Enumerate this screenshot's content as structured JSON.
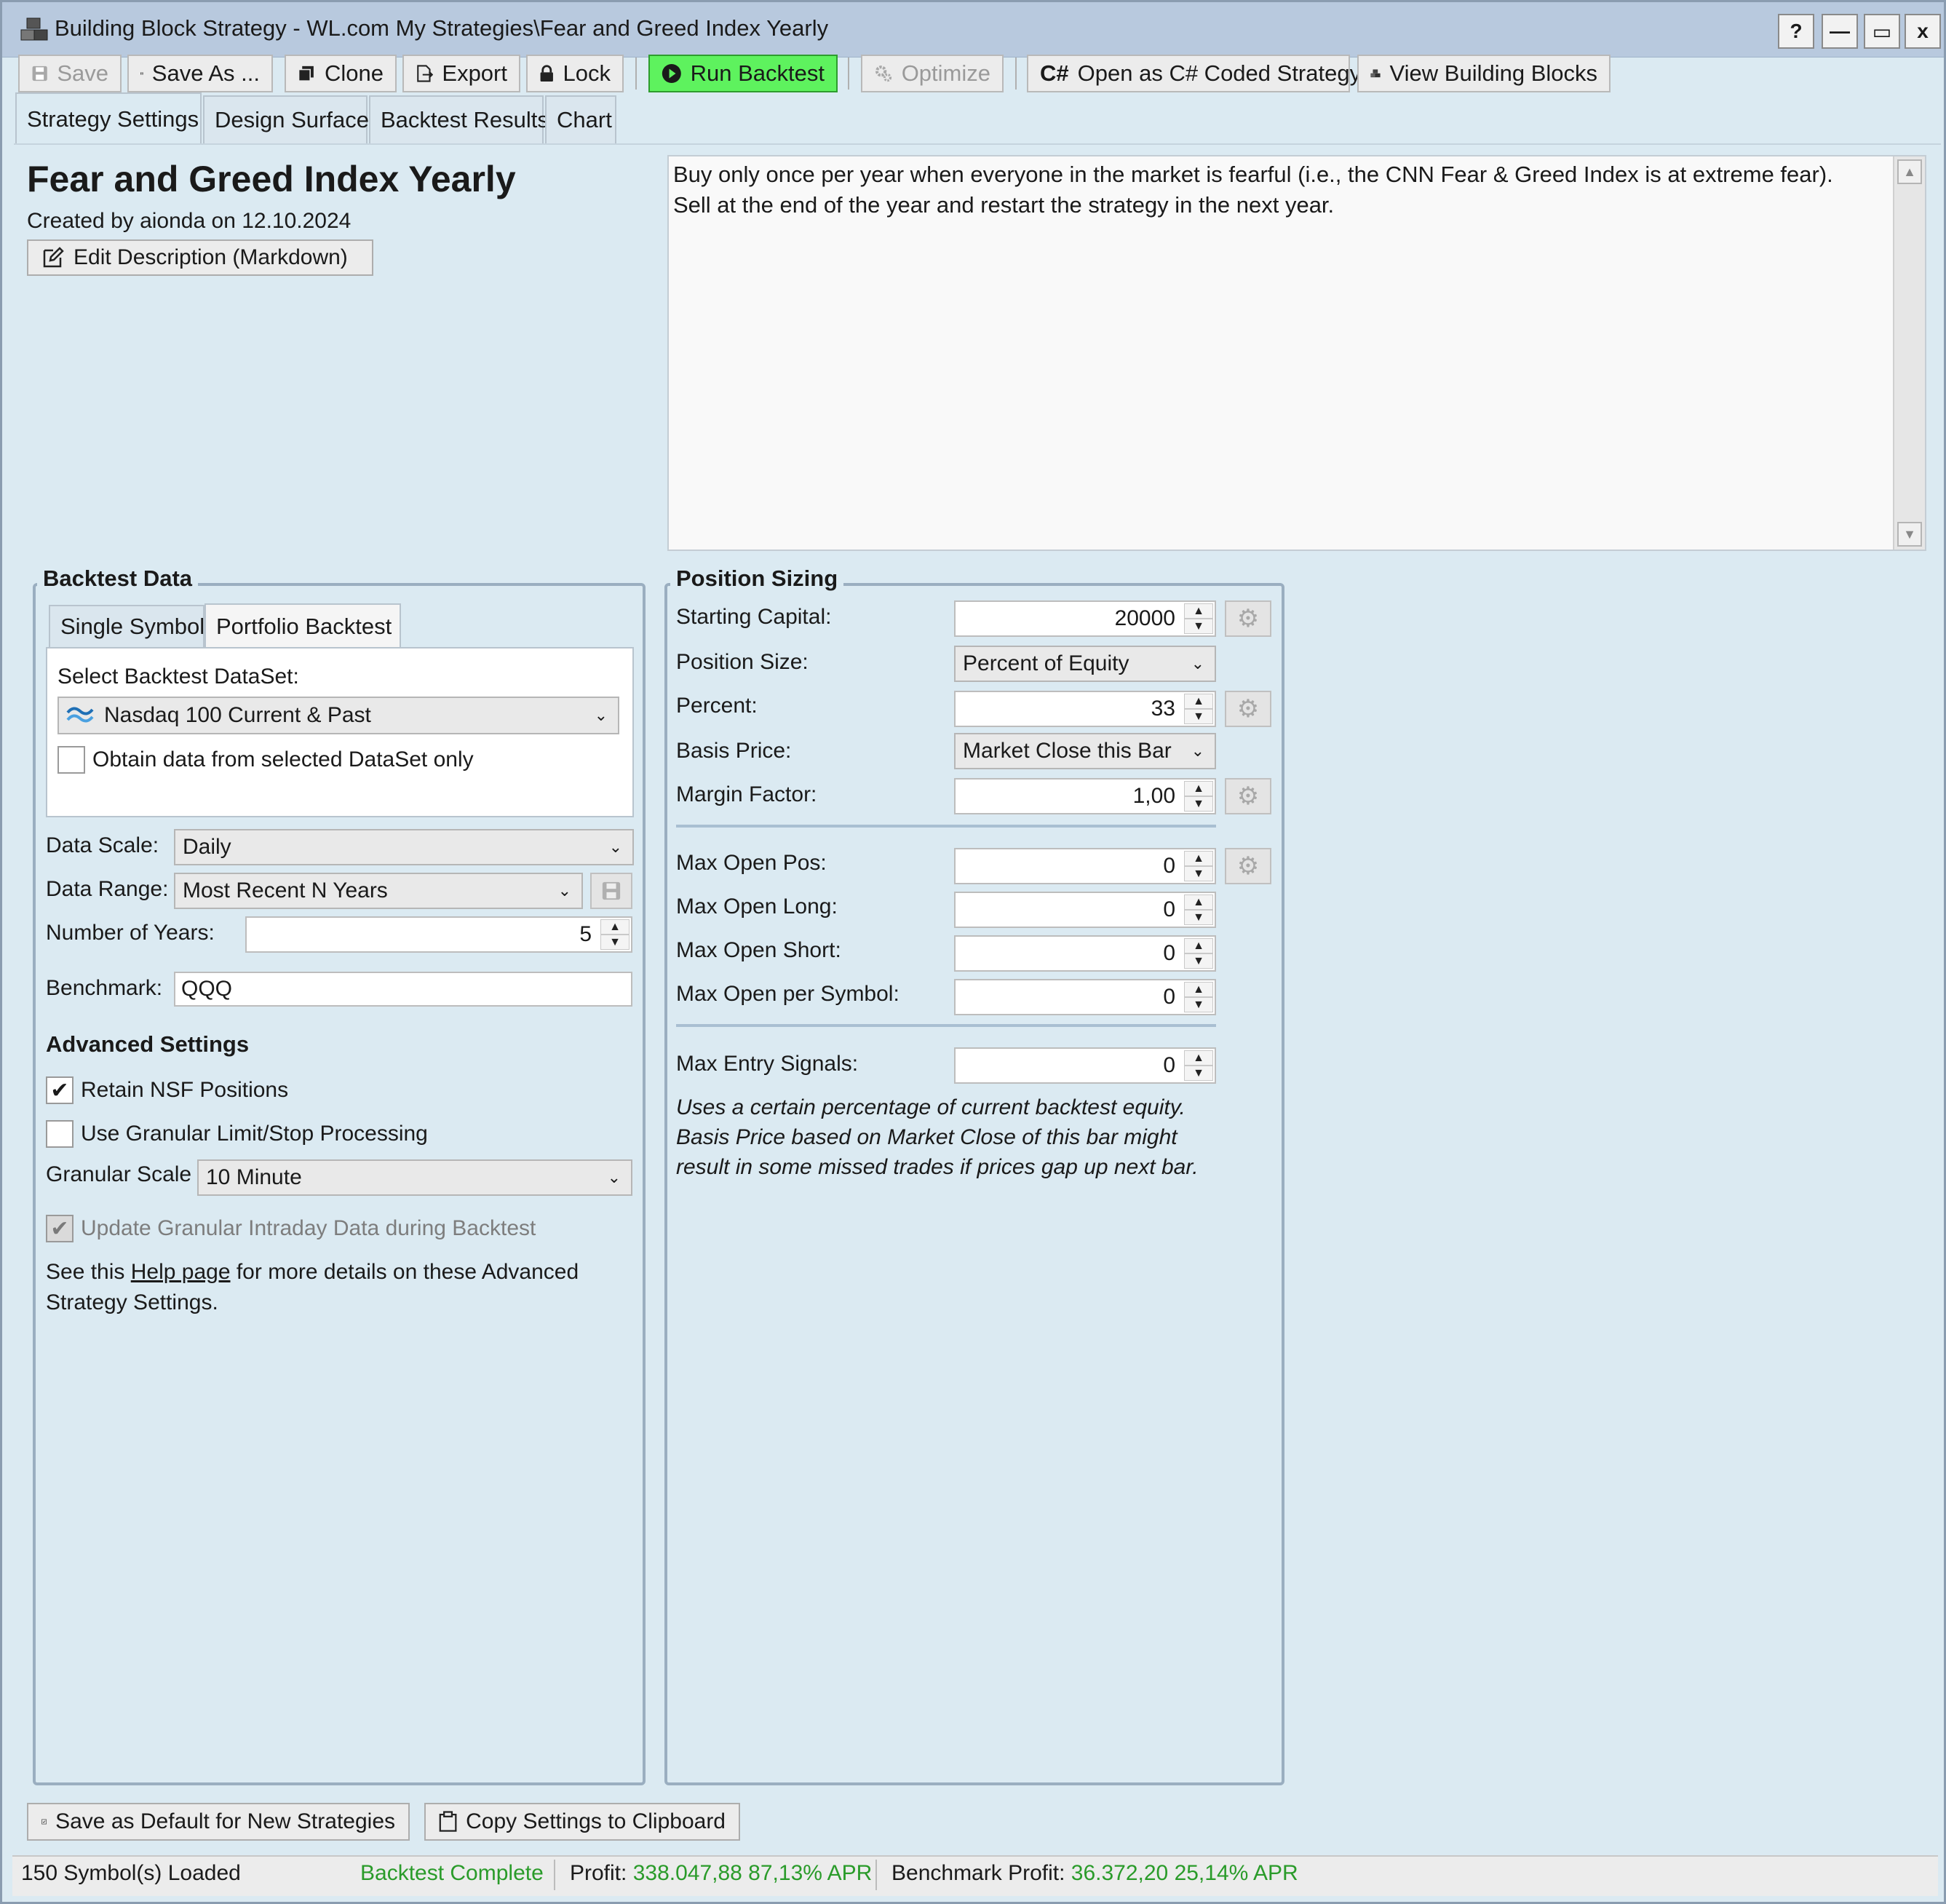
{
  "window": {
    "title": "Building Block Strategy - WL.com My Strategies\\Fear and Greed Index Yearly",
    "help_label": "?",
    "minimize_label": "—",
    "maximize_label": "▭",
    "close_label": "x"
  },
  "toolbar": {
    "save": "Save",
    "save_as": "Save As ...",
    "clone": "Clone",
    "export": "Export",
    "lock": "Lock",
    "run_backtest": "Run Backtest",
    "optimize": "Optimize",
    "open_csharp_badge": "C#",
    "open_csharp": "Open as C# Coded Strategy",
    "view_blocks": "View Building Blocks"
  },
  "tabs": [
    {
      "label": "Strategy Settings",
      "active": true
    },
    {
      "label": "Design Surface",
      "active": false
    },
    {
      "label": "Backtest Results",
      "active": false
    },
    {
      "label": "Chart",
      "active": false
    }
  ],
  "strategy": {
    "title": "Fear and Greed Index Yearly",
    "created_by": "Created by aionda on 12.10.2024",
    "edit_description": "Edit Description (Markdown)",
    "description": "Buy only once per year when everyone in the market is fearful (i.e., the CNN Fear & Greed Index is at extreme fear).\nSell at the end of the year and restart the strategy in the next year."
  },
  "backtest_data": {
    "group_label": "Backtest Data",
    "subtabs": [
      {
        "label": "Single Symbol",
        "active": false
      },
      {
        "label": "Portfolio Backtest",
        "active": true
      }
    ],
    "select_dataset_label": "Select Backtest DataSet:",
    "dataset_value": "Nasdaq 100 Current & Past",
    "obtain_only_label": "Obtain data from selected DataSet only",
    "obtain_only_checked": false,
    "data_scale_label": "Data Scale:",
    "data_scale_value": "Daily",
    "data_range_label": "Data Range:",
    "data_range_value": "Most Recent N Years",
    "num_years_label": "Number of Years:",
    "num_years_value": "5",
    "benchmark_label": "Benchmark:",
    "benchmark_value": "QQQ"
  },
  "advanced": {
    "heading": "Advanced Settings",
    "retain_nsf_label": "Retain NSF Positions",
    "retain_nsf_checked": true,
    "granular_limit_label": "Use Granular Limit/Stop Processing",
    "granular_limit_checked": false,
    "granular_scale_label": "Granular Scale",
    "granular_scale_value": "10 Minute",
    "update_granular_label": "Update Granular Intraday Data during Backtest",
    "update_granular_checked": true,
    "help_text_before": "See this ",
    "help_link": "Help page",
    "help_text_after": " for more details on these Advanced",
    "help_text_line2": "Strategy Settings."
  },
  "position_sizing": {
    "group_label": "Position Sizing",
    "starting_capital_label": "Starting Capital:",
    "starting_capital_value": "20000",
    "position_size_label": "Position Size:",
    "position_size_value": "Percent of Equity",
    "percent_label": "Percent:",
    "percent_value": "33",
    "basis_price_label": "Basis Price:",
    "basis_price_value": "Market Close this Bar",
    "margin_factor_label": "Margin Factor:",
    "margin_factor_value": "1,00",
    "max_open_pos_label": "Max Open Pos:",
    "max_open_pos_value": "0",
    "max_open_long_label": "Max Open Long:",
    "max_open_long_value": "0",
    "max_open_short_label": "Max Open Short:",
    "max_open_short_value": "0",
    "max_open_per_symbol_label": "Max Open per Symbol:",
    "max_open_per_symbol_value": "0",
    "max_entry_signals_label": "Max Entry Signals:",
    "max_entry_signals_value": "0",
    "note_line1": "Uses a certain percentage of current backtest equity.",
    "note_line2": "Basis Price based on Market Close of this bar might",
    "note_line3": "result in some missed trades if prices gap up next bar."
  },
  "footer": {
    "save_default": "Save as Default for New Strategies",
    "copy_settings": "Copy Settings to Clipboard"
  },
  "status": {
    "symbols_loaded": "150 Symbol(s) Loaded",
    "backtest_state": "Backtest Complete",
    "profit_label": "Profit:",
    "profit_value": "338.047,88 87,13% APR",
    "benchmark_profit_label": "Benchmark Profit:",
    "benchmark_profit_value": "36.372,20 25,14% APR"
  },
  "colors": {
    "window_bg": "#dbeaf2",
    "title_bar": "#b8c9de",
    "run_button": "#5ef25e",
    "status_green": "#2a9b2a"
  },
  "icons": {
    "app": "blocks-icon",
    "save": "floppy-icon",
    "clone": "copy-icon",
    "export": "export-icon",
    "lock": "lock-icon",
    "run": "play-circle-icon",
    "optimize": "gears-icon",
    "edit": "edit-icon",
    "dataset": "waves-icon",
    "clipboard": "clipboard-icon"
  }
}
